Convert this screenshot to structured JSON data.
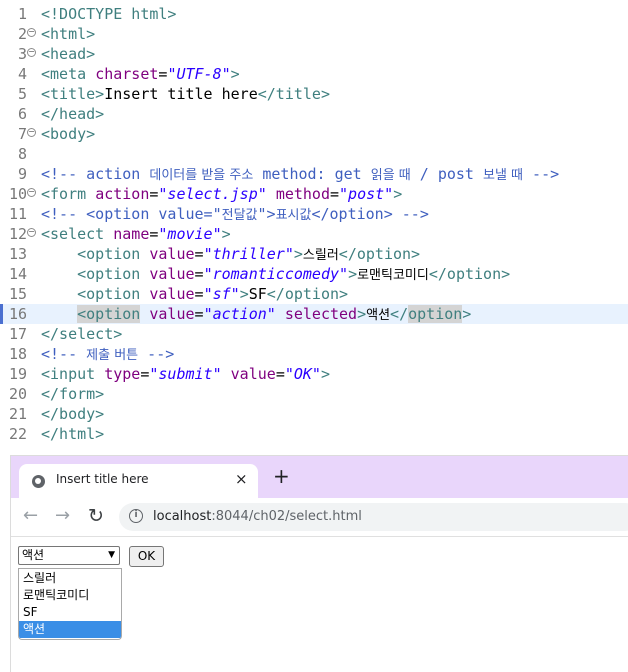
{
  "editor": {
    "lines": [
      {
        "n": "1",
        "fold": false,
        "tokens": [
          {
            "t": "<!DOCTYPE html>",
            "c": "tag"
          }
        ]
      },
      {
        "n": "2",
        "fold": true,
        "tokens": [
          {
            "t": "<html>",
            "c": "tag"
          }
        ]
      },
      {
        "n": "3",
        "fold": true,
        "tokens": [
          {
            "t": "<head>",
            "c": "tag"
          }
        ]
      },
      {
        "n": "4",
        "fold": false,
        "tokens": [
          {
            "t": "<meta ",
            "c": "tag"
          },
          {
            "t": "charset",
            "c": "attr"
          },
          {
            "t": "=",
            "c": "text"
          },
          {
            "t": "\"UTF-8\"",
            "c": "val"
          },
          {
            "t": ">",
            "c": "tag"
          }
        ]
      },
      {
        "n": "5",
        "fold": false,
        "tokens": [
          {
            "t": "<title>",
            "c": "tag"
          },
          {
            "t": "Insert title here",
            "c": "text"
          },
          {
            "t": "</title>",
            "c": "tag"
          }
        ]
      },
      {
        "n": "6",
        "fold": false,
        "tokens": [
          {
            "t": "</head>",
            "c": "tag"
          }
        ]
      },
      {
        "n": "7",
        "fold": true,
        "tokens": [
          {
            "t": "<body>",
            "c": "tag"
          }
        ]
      },
      {
        "n": "8",
        "fold": false,
        "tokens": []
      },
      {
        "n": "9",
        "fold": false,
        "tokens": [
          {
            "t": "<!-- action ",
            "c": "cmt"
          },
          {
            "t": "데이터를 받을 주소",
            "c": "cmt kr"
          },
          {
            "t": " method: get ",
            "c": "cmt"
          },
          {
            "t": "읽을 때",
            "c": "cmt kr"
          },
          {
            "t": " / post ",
            "c": "cmt"
          },
          {
            "t": "보낼 때",
            "c": "cmt kr"
          },
          {
            "t": " -->",
            "c": "cmt"
          }
        ]
      },
      {
        "n": "10",
        "fold": true,
        "tokens": [
          {
            "t": "<form ",
            "c": "tag"
          },
          {
            "t": "action",
            "c": "attr"
          },
          {
            "t": "=",
            "c": "text"
          },
          {
            "t": "\"select.jsp\"",
            "c": "val"
          },
          {
            "t": " ",
            "c": "text"
          },
          {
            "t": "method",
            "c": "attr"
          },
          {
            "t": "=",
            "c": "text"
          },
          {
            "t": "\"post\"",
            "c": "val"
          },
          {
            "t": ">",
            "c": "tag"
          }
        ]
      },
      {
        "n": "11",
        "fold": false,
        "tokens": [
          {
            "t": "<!-- <option value=\"",
            "c": "cmt"
          },
          {
            "t": "전달값",
            "c": "cmt kr"
          },
          {
            "t": "\">",
            "c": "cmt"
          },
          {
            "t": "표시값",
            "c": "cmt kr"
          },
          {
            "t": "</option> -->",
            "c": "cmt"
          }
        ]
      },
      {
        "n": "12",
        "fold": true,
        "tokens": [
          {
            "t": "<select ",
            "c": "tag"
          },
          {
            "t": "name",
            "c": "attr"
          },
          {
            "t": "=",
            "c": "text"
          },
          {
            "t": "\"movie\"",
            "c": "val"
          },
          {
            "t": ">",
            "c": "tag"
          }
        ]
      },
      {
        "n": "13",
        "fold": false,
        "tokens": [
          {
            "t": "    ",
            "c": "text"
          },
          {
            "t": "<option ",
            "c": "tag"
          },
          {
            "t": "value",
            "c": "attr"
          },
          {
            "t": "=",
            "c": "text"
          },
          {
            "t": "\"thriller\"",
            "c": "val"
          },
          {
            "t": ">",
            "c": "tag"
          },
          {
            "t": "스릴러",
            "c": "text kr"
          },
          {
            "t": "</option>",
            "c": "tag"
          }
        ]
      },
      {
        "n": "14",
        "fold": false,
        "tokens": [
          {
            "t": "    ",
            "c": "text"
          },
          {
            "t": "<option ",
            "c": "tag"
          },
          {
            "t": "value",
            "c": "attr"
          },
          {
            "t": "=",
            "c": "text"
          },
          {
            "t": "\"romanticcomedy\"",
            "c": "val"
          },
          {
            "t": ">",
            "c": "tag"
          },
          {
            "t": "로맨틱코미디",
            "c": "text kr"
          },
          {
            "t": "</option>",
            "c": "tag"
          }
        ]
      },
      {
        "n": "15",
        "fold": false,
        "tokens": [
          {
            "t": "    ",
            "c": "text"
          },
          {
            "t": "<option ",
            "c": "tag"
          },
          {
            "t": "value",
            "c": "attr"
          },
          {
            "t": "=",
            "c": "text"
          },
          {
            "t": "\"sf\"",
            "c": "val"
          },
          {
            "t": ">",
            "c": "tag"
          },
          {
            "t": "SF",
            "c": "text"
          },
          {
            "t": "</option>",
            "c": "tag"
          }
        ]
      },
      {
        "n": "16",
        "fold": false,
        "current": true,
        "tokens": [
          {
            "t": "    ",
            "c": "text"
          },
          {
            "t": "<option",
            "c": "tag hl"
          },
          {
            "t": " ",
            "c": "text"
          },
          {
            "t": "value",
            "c": "attr"
          },
          {
            "t": "=",
            "c": "text"
          },
          {
            "t": "\"action\"",
            "c": "val"
          },
          {
            "t": " ",
            "c": "text"
          },
          {
            "t": "selected",
            "c": "attr"
          },
          {
            "t": ">",
            "c": "tag"
          },
          {
            "t": "액션",
            "c": "text kr"
          },
          {
            "t": "</",
            "c": "tag"
          },
          {
            "t": "option",
            "c": "tag hl"
          },
          {
            "t": ">",
            "c": "tag"
          }
        ]
      },
      {
        "n": "17",
        "fold": false,
        "tokens": [
          {
            "t": "</select>",
            "c": "tag"
          }
        ]
      },
      {
        "n": "18",
        "fold": false,
        "tokens": [
          {
            "t": "<!-- ",
            "c": "cmt"
          },
          {
            "t": "제출 버튼",
            "c": "cmt kr"
          },
          {
            "t": " -->",
            "c": "cmt"
          }
        ]
      },
      {
        "n": "19",
        "fold": false,
        "tokens": [
          {
            "t": "<input ",
            "c": "tag"
          },
          {
            "t": "type",
            "c": "attr"
          },
          {
            "t": "=",
            "c": "text"
          },
          {
            "t": "\"submit\"",
            "c": "val"
          },
          {
            "t": " ",
            "c": "text"
          },
          {
            "t": "value",
            "c": "attr"
          },
          {
            "t": "=",
            "c": "text"
          },
          {
            "t": "\"OK\"",
            "c": "val"
          },
          {
            "t": ">",
            "c": "tag"
          }
        ]
      },
      {
        "n": "20",
        "fold": false,
        "tokens": [
          {
            "t": "</form>",
            "c": "tag"
          }
        ]
      },
      {
        "n": "21",
        "fold": false,
        "tokens": [
          {
            "t": "</body>",
            "c": "tag"
          }
        ]
      },
      {
        "n": "22",
        "fold": false,
        "tokens": [
          {
            "t": "</html>",
            "c": "tag"
          }
        ]
      }
    ]
  },
  "browser": {
    "tab": {
      "title": "Insert title here",
      "favicon": "globe-icon",
      "close": "×"
    },
    "new_tab": "+",
    "nav": {
      "back": "←",
      "forward": "→",
      "reload": "↻"
    },
    "omnibox": {
      "info": "i",
      "host": "localhost",
      "rest": ":8044/ch02/select.html"
    },
    "page": {
      "select_value": "액션",
      "select_arrow": "▼",
      "ok_label": "OK",
      "options": [
        "스릴러",
        "로맨틱코미디",
        "SF",
        "액션"
      ],
      "selected_index": 3
    }
  },
  "colors": {
    "tag": "#3f7f7f",
    "attr": "#7f007f",
    "value": "#2a00ff",
    "comment": "#3f5fbf",
    "tabstrip": "#e9d6fb",
    "selected_option": "#3a8ee6",
    "current_line": "#e8f2fe"
  }
}
